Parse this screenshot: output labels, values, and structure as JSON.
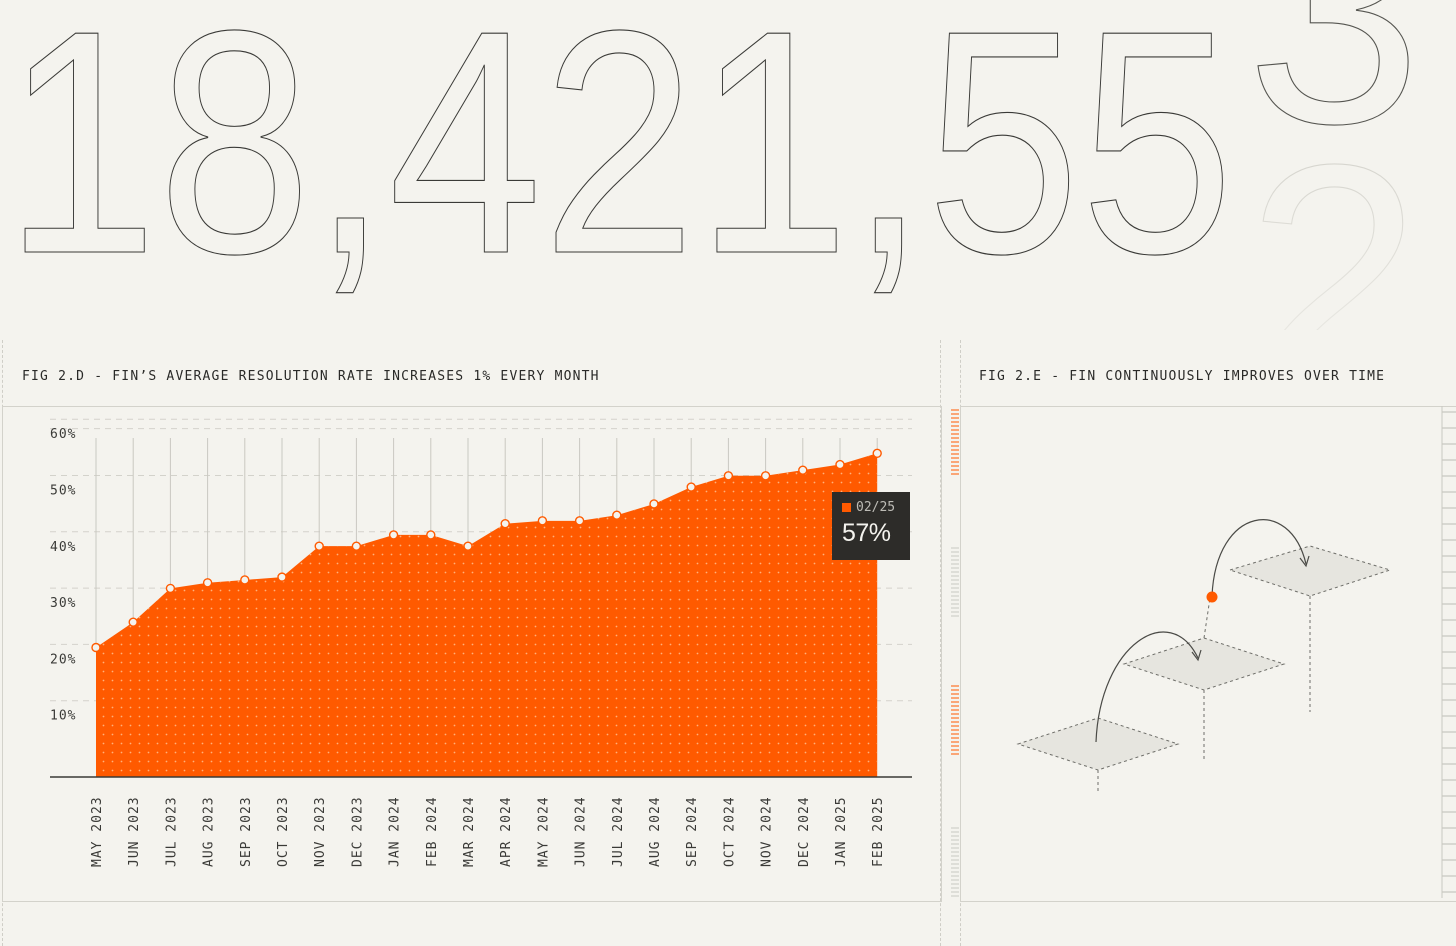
{
  "headline": {
    "number_text": "18,421,55",
    "rolling_digit_top": "3",
    "rolling_digit_bottom": "2"
  },
  "figures": {
    "fig_d_title": "FIG 2.D - FIN’S AVERAGE RESOLUTION RATE INCREASES 1% EVERY MONTH",
    "fig_e_title": "FIG 2.E - FIN CONTINUOUSLY IMPROVES OVER TIME"
  },
  "tooltip": {
    "date": "02/25",
    "value": "57%"
  },
  "colors": {
    "accent": "#ff5a00",
    "background": "#f4f3ee",
    "ink": "#2a2a28",
    "grid": "#cfcec7",
    "tooltip_bg": "#2d2c29"
  },
  "chart_data": {
    "type": "area",
    "title": "FIG 2.D - FIN’S AVERAGE RESOLUTION RATE INCREASES 1% EVERY MONTH",
    "xlabel": "",
    "ylabel": "",
    "categories": [
      "MAY 2023",
      "JUN 2023",
      "JUL 2023",
      "AUG 2023",
      "SEP 2023",
      "OCT 2023",
      "NOV 2023",
      "DEC 2023",
      "JAN 2024",
      "FEB 2024",
      "MAR 2024",
      "APR 2024",
      "MAY 2024",
      "JUN 2024",
      "JUL 2024",
      "AUG 2024",
      "SEP 2024",
      "OCT 2024",
      "NOV 2024",
      "DEC 2024",
      "JAN 2025",
      "FEB 2025"
    ],
    "values": [
      23,
      27.5,
      33.5,
      34.5,
      35,
      35.5,
      41,
      41,
      43,
      43,
      41,
      45,
      45.5,
      45.5,
      46.5,
      48.5,
      51.5,
      53.5,
      53.5,
      54.5,
      55.5,
      57.5
    ],
    "y_ticks": [
      "10%",
      "20%",
      "30%",
      "40%",
      "50%",
      "60%"
    ],
    "y_tick_values": [
      10,
      20,
      30,
      40,
      50,
      60
    ],
    "ylim": [
      0,
      64
    ],
    "grid": true,
    "legend": "none",
    "series_color": "#ff5a00"
  }
}
